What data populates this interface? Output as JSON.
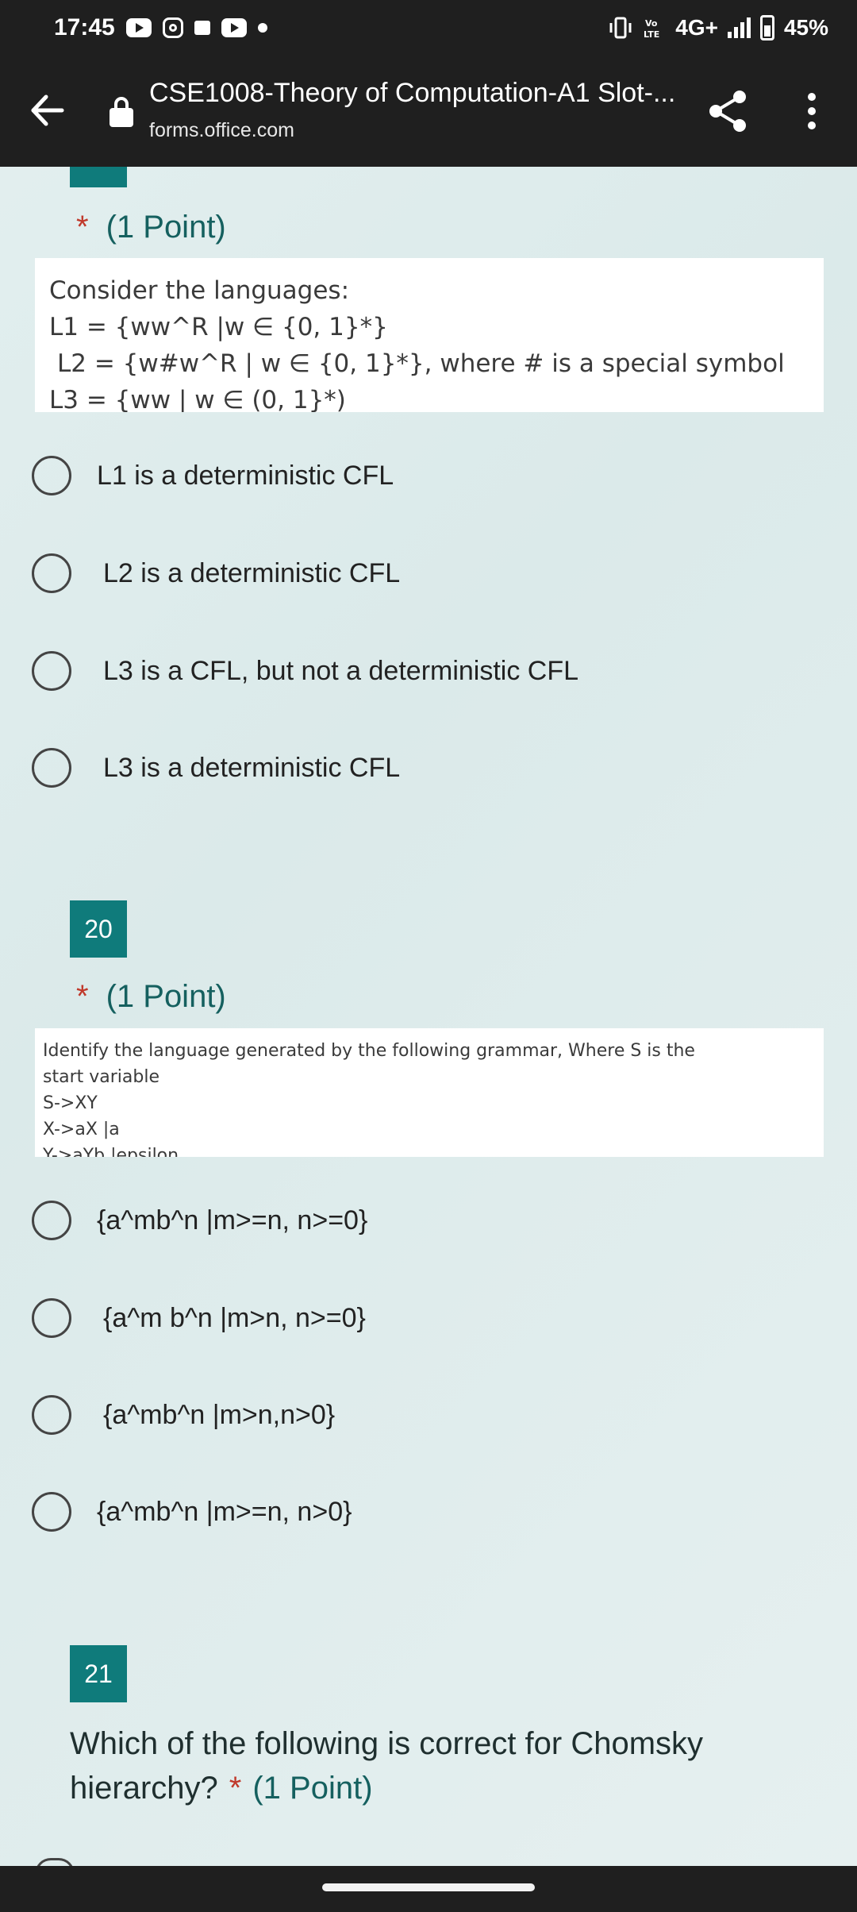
{
  "status_bar": {
    "time": "17:45",
    "network_label": "4G+",
    "battery": "45%",
    "icons": [
      "youtube-icon",
      "instagram-icon",
      "gift-icon",
      "youtube-icon",
      "dot-icon",
      "vibrate-icon",
      "volte-icon",
      "signal-icon",
      "battery-icon"
    ]
  },
  "browser": {
    "title": "CSE1008-Theory of Computation-A1 Slot-...",
    "url": "forms.office.com",
    "icons": [
      "back-arrow-icon",
      "lock-icon",
      "share-icon",
      "more-vert-icon"
    ]
  },
  "questions": [
    {
      "points_label": "(1 Point)",
      "image_lines": [
        "Consider the languages:",
        "L1 = {ww^R |w ∈ {0, 1}*}",
        " L2 = {w#w^R | w ∈ {0, 1}*}, where # is a special symbol",
        "L3 = {ww | w ∈ (0, 1}*)"
      ],
      "options": [
        "L1 is a deterministic CFL",
        "L2 is a deterministic CFL",
        "L3 is a CFL, but not a deterministic CFL",
        "L3 is a deterministic CFL"
      ]
    },
    {
      "number": "20",
      "points_label": "(1 Point)",
      "image_lines": [
        "Identify the language generated by the following grammar, Where S is the",
        "start variable",
        "S->XY",
        "X->aX |a",
        "Y->aYb |epsilon"
      ],
      "options": [
        "{a^mb^n |m>=n, n>=0}",
        "{a^m b^n |m>n, n>=0}",
        "{a^mb^n |m>n,n>0}",
        "{a^mb^n |m>=n, n>0}"
      ]
    },
    {
      "number": "21",
      "text": "Which of the following is correct for Chomsky hierarchy?",
      "points_label": "(1 Point)"
    }
  ],
  "required_marker": "*",
  "colors": {
    "accent": "#0f7b7b",
    "required": "#c0392b",
    "points_text": "#15605f",
    "bars": "#1f1f1f"
  }
}
